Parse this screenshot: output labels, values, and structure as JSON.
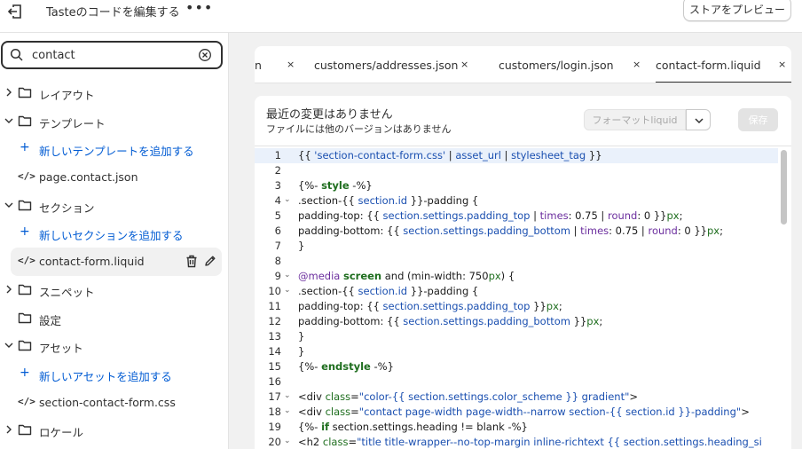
{
  "header": {
    "title": "Tasteのコードを編集する",
    "more": "•••",
    "preview_label": "ストアをプレビュー"
  },
  "search": {
    "value": "contact",
    "placeholder": ""
  },
  "tree": [
    {
      "type": "folder",
      "label": "レイアウト",
      "expanded": false
    },
    {
      "type": "folder",
      "label": "テンプレート",
      "expanded": true
    },
    {
      "type": "add",
      "label": "新しいテンプレートを追加する"
    },
    {
      "type": "file",
      "label": "page.contact.json"
    },
    {
      "type": "folder",
      "label": "セクション",
      "expanded": true
    },
    {
      "type": "add",
      "label": "新しいセクションを追加する"
    },
    {
      "type": "file",
      "label": "contact-form.liquid",
      "selected": true
    },
    {
      "type": "folder",
      "label": "スニペット",
      "expanded": false
    },
    {
      "type": "folder-plain",
      "label": "設定"
    },
    {
      "type": "folder",
      "label": "アセット",
      "expanded": true
    },
    {
      "type": "add",
      "label": "新しいアセットを追加する"
    },
    {
      "type": "file",
      "label": "section-contact-form.css"
    },
    {
      "type": "folder",
      "label": "ロケール",
      "expanded": false
    }
  ],
  "tabs": [
    {
      "label": "n",
      "active": false
    },
    {
      "label": "customers/addresses.json",
      "active": false
    },
    {
      "label": "customers/login.json",
      "active": false
    },
    {
      "label": "contact-form.liquid",
      "active": true
    }
  ],
  "tab_close": "×",
  "status": {
    "line1": "最近の変更はありません",
    "line2": "ファイルには他のバージョンはありません"
  },
  "format_label": "フォーマットliquid",
  "save_label": "保存",
  "code_lines": [
    {
      "n": "1",
      "fold": "",
      "html": "{{ <span class=\"s\">'section-contact-form.css'</span> | <span class=\"s\">asset_url</span> | <span class=\"s\">stylesheet_tag</span> }}"
    },
    {
      "n": "2",
      "fold": "",
      "html": ""
    },
    {
      "n": "3",
      "fold": "",
      "html": "{%- <span class=\"b\">style</span> -%}"
    },
    {
      "n": "4",
      "fold": "⌄",
      "html": " .section-{{ <span class=\"s\">section.id</span> }}-padding {"
    },
    {
      "n": "5",
      "fold": "",
      "html": "   padding-top: {{ <span class=\"s\">section.settings.padding_top</span> | <span class=\"p\">times</span>: 0.75 | <span class=\"p\">round</span>: 0 }}<span class=\"k\">px</span>;"
    },
    {
      "n": "6",
      "fold": "",
      "html": "   padding-bottom: {{ <span class=\"s\">section.settings.padding_bottom</span> | <span class=\"p\">times</span>: 0.75 | <span class=\"p\">round</span>: 0 }}<span class=\"k\">px</span>;"
    },
    {
      "n": "7",
      "fold": "",
      "html": " }"
    },
    {
      "n": "8",
      "fold": "",
      "html": ""
    },
    {
      "n": "9",
      "fold": "⌄",
      "html": " <span class=\"p\">@media</span> <span class=\"b\">screen</span> and (min-width: 750<span class=\"k\">px</span>) {"
    },
    {
      "n": "10",
      "fold": "⌄",
      "html": "  .section-{{ <span class=\"s\">section.id</span> }}-padding {"
    },
    {
      "n": "11",
      "fold": "",
      "html": "    padding-top: {{ <span class=\"s\">section.settings.padding_top</span> }}<span class=\"k\">px</span>;"
    },
    {
      "n": "12",
      "fold": "",
      "html": "    padding-bottom: {{ <span class=\"s\">section.settings.padding_bottom</span> }}<span class=\"k\">px</span>;"
    },
    {
      "n": "13",
      "fold": "",
      "html": "  }"
    },
    {
      "n": "14",
      "fold": "",
      "html": " }"
    },
    {
      "n": "15",
      "fold": "",
      "html": "{%- <span class=\"b\">endstyle</span> -%}"
    },
    {
      "n": "16",
      "fold": "",
      "html": ""
    },
    {
      "n": "17",
      "fold": "⌄",
      "html": "&lt;div <span class=\"k\">class</span>=<span class=\"s\">\"color-{{ section.settings.color_scheme }} gradient\"</span>&gt;"
    },
    {
      "n": "18",
      "fold": "⌄",
      "html": "  &lt;div <span class=\"k\">class</span>=<span class=\"s\">\"contact page-width page-width--narrow section-{{ section.id }}-padding\"</span>&gt;"
    },
    {
      "n": "19",
      "fold": "",
      "html": "    {%- <span class=\"b\">if</span> section.settings.heading != blank -%}"
    },
    {
      "n": "20",
      "fold": "⌄",
      "html": "      &lt;h2 <span class=\"k\">class</span>=<span class=\"s\">\"title title-wrapper--no-top-margin inline-richtext {{ section.settings.heading_si</span>"
    }
  ]
}
